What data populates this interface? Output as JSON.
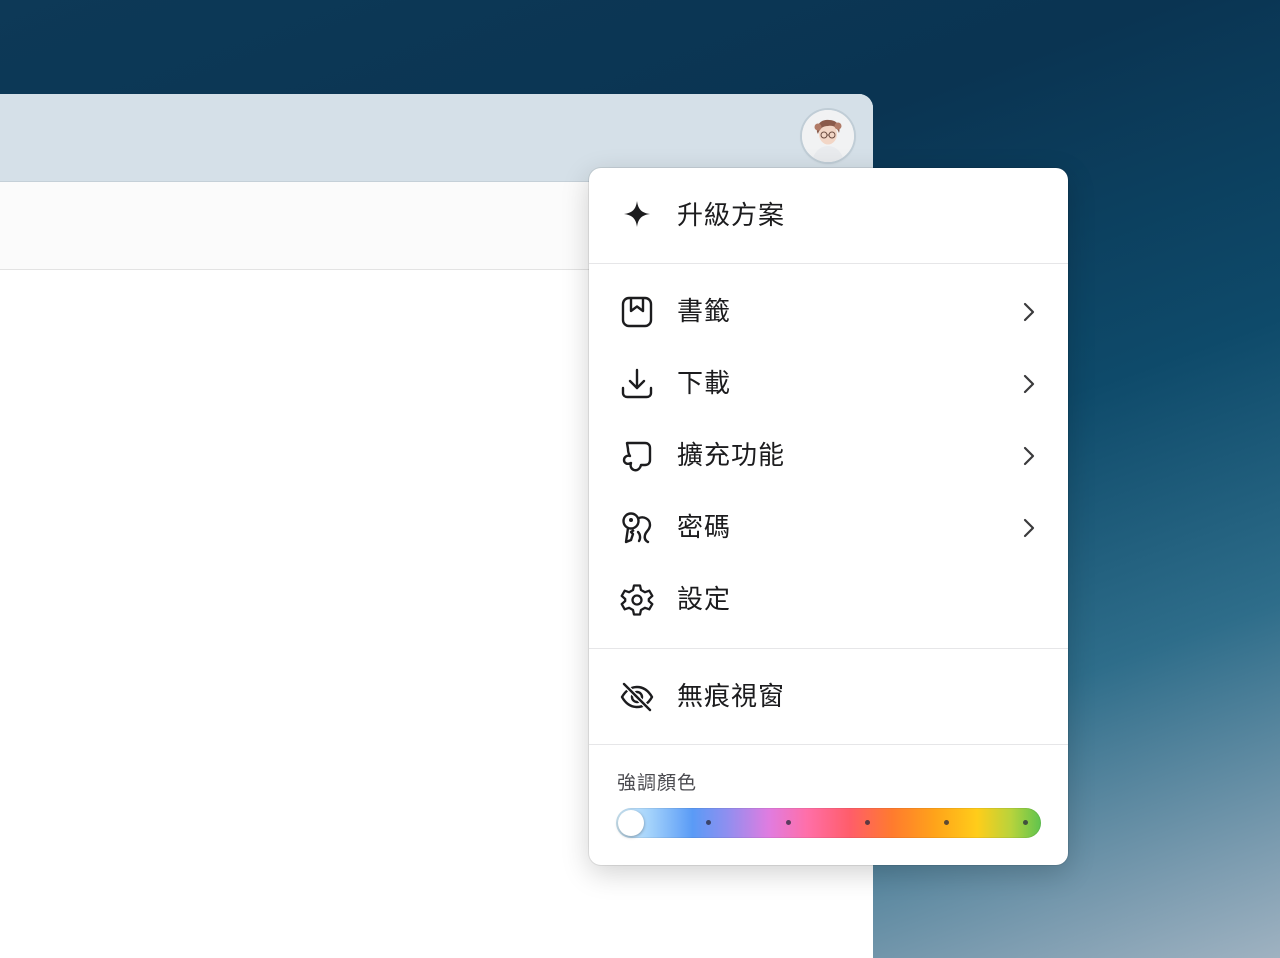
{
  "colors": {
    "desktop_top": "#0a3452",
    "titlebar": "#d5e0e8",
    "menu_bg": "#ffffff",
    "text": "#1c1c1e",
    "muted_text": "#4a4a4f"
  },
  "profile": {
    "avatar_icon": "user-avatar-photo"
  },
  "menu": {
    "upgrade": {
      "label": "升級方案",
      "icon": "sparkle-icon"
    },
    "items": [
      {
        "label": "書籤",
        "icon": "bookmark-icon",
        "has_submenu": true
      },
      {
        "label": "下載",
        "icon": "download-icon",
        "has_submenu": true
      },
      {
        "label": "擴充功能",
        "icon": "puzzle-icon",
        "has_submenu": true
      },
      {
        "label": "密碼",
        "icon": "key-icon",
        "has_submenu": true
      },
      {
        "label": "設定",
        "icon": "gear-icon",
        "has_submenu": false
      }
    ],
    "incognito": {
      "label": "無痕視窗",
      "icon": "eye-off-icon"
    },
    "accent": {
      "label": "強調顏色",
      "selected_index": 0,
      "stops": [
        "#d4eefc",
        "#5a9bf6",
        "#ff6fa8",
        "#ff7b2e",
        "#ffcd1a",
        "#5fc44e"
      ]
    }
  }
}
